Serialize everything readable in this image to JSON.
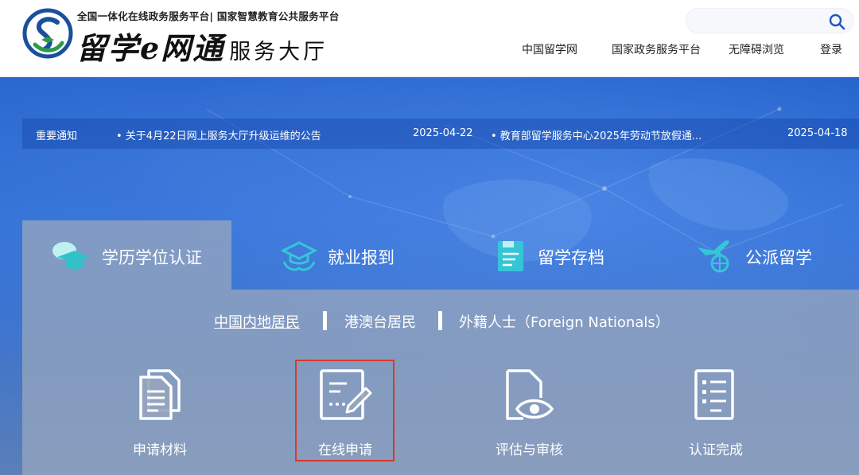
{
  "header": {
    "tagline": "全国一体化在线政务服务平台| 国家智慧教育公共服务平台",
    "brand_script": "留学e网通",
    "brand_sub": "服务大厅",
    "nav": [
      "中国留学网",
      "国家政务服务平台",
      "无障碍浏览",
      "登录"
    ]
  },
  "search": {
    "placeholder": ""
  },
  "notices": {
    "label": "重要通知",
    "items": [
      {
        "text": "• 关于4月22日网上服务大厅升级运维的公告",
        "date": "2025-04-22"
      },
      {
        "text": "• 教育部留学服务中心2025年劳动节放假通...",
        "date": "2025-04-18"
      }
    ]
  },
  "tabs": [
    {
      "label": "学历学位认证",
      "icon": "graduation-cap-icon",
      "active": true
    },
    {
      "label": "就业报到",
      "icon": "hat-hands-icon",
      "active": false
    },
    {
      "label": "留学存档",
      "icon": "archive-document-icon",
      "active": false
    },
    {
      "label": "公派留学",
      "icon": "plane-globe-icon",
      "active": false
    }
  ],
  "subtabs": [
    "中国内地居民",
    "港澳台居民",
    "外籍人士（Foreign Nationals）"
  ],
  "steps": [
    {
      "label": "申请材料",
      "icon": "documents-icon"
    },
    {
      "label": "在线申请",
      "icon": "form-edit-icon"
    },
    {
      "label": "评估与审核",
      "icon": "document-eye-icon"
    },
    {
      "label": "认证完成",
      "icon": "checklist-icon"
    }
  ],
  "colors": {
    "hero_blue": "#2f6fd6",
    "panel_gray": "#96a5be",
    "highlight_red": "#d53a2f",
    "logo_blue": "#1a4f9c",
    "logo_green": "#2e9b4a"
  }
}
